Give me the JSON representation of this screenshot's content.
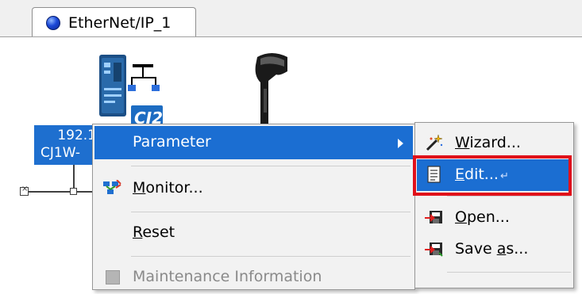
{
  "tab": {
    "label": "EtherNet/IP_1"
  },
  "device": {
    "model_badge": "CJ2",
    "label_line1": "192.1",
    "label_line2": "CJ1W-"
  },
  "context_menu": {
    "items": [
      {
        "label": "Parameter",
        "has_submenu": true,
        "highlighted": true
      },
      {
        "label_mnemonic": "M",
        "label_rest": "onitor...",
        "icon": "monitor-icon"
      },
      {
        "label_mnemonic": "R",
        "label_rest": "eset"
      },
      {
        "label": "Maintenance Information",
        "enabled": false
      }
    ]
  },
  "submenu": {
    "items": [
      {
        "label_mnemonic": "W",
        "label_rest": "izard...",
        "icon": "wizard-wand-icon"
      },
      {
        "label_mnemonic": "E",
        "label_rest": "dit...",
        "icon": "edit-document-icon",
        "highlighted": true,
        "outlined": true
      },
      {
        "label_mnemonic": "O",
        "label_rest": "pen...",
        "icon": "open-file-icon"
      },
      {
        "label_start": "Save ",
        "label_mnemonic": "a",
        "label_rest": "s...",
        "icon": "save-as-icon"
      }
    ]
  },
  "colors": {
    "highlight": "#1b6ed2",
    "outline": "#e0101a"
  }
}
